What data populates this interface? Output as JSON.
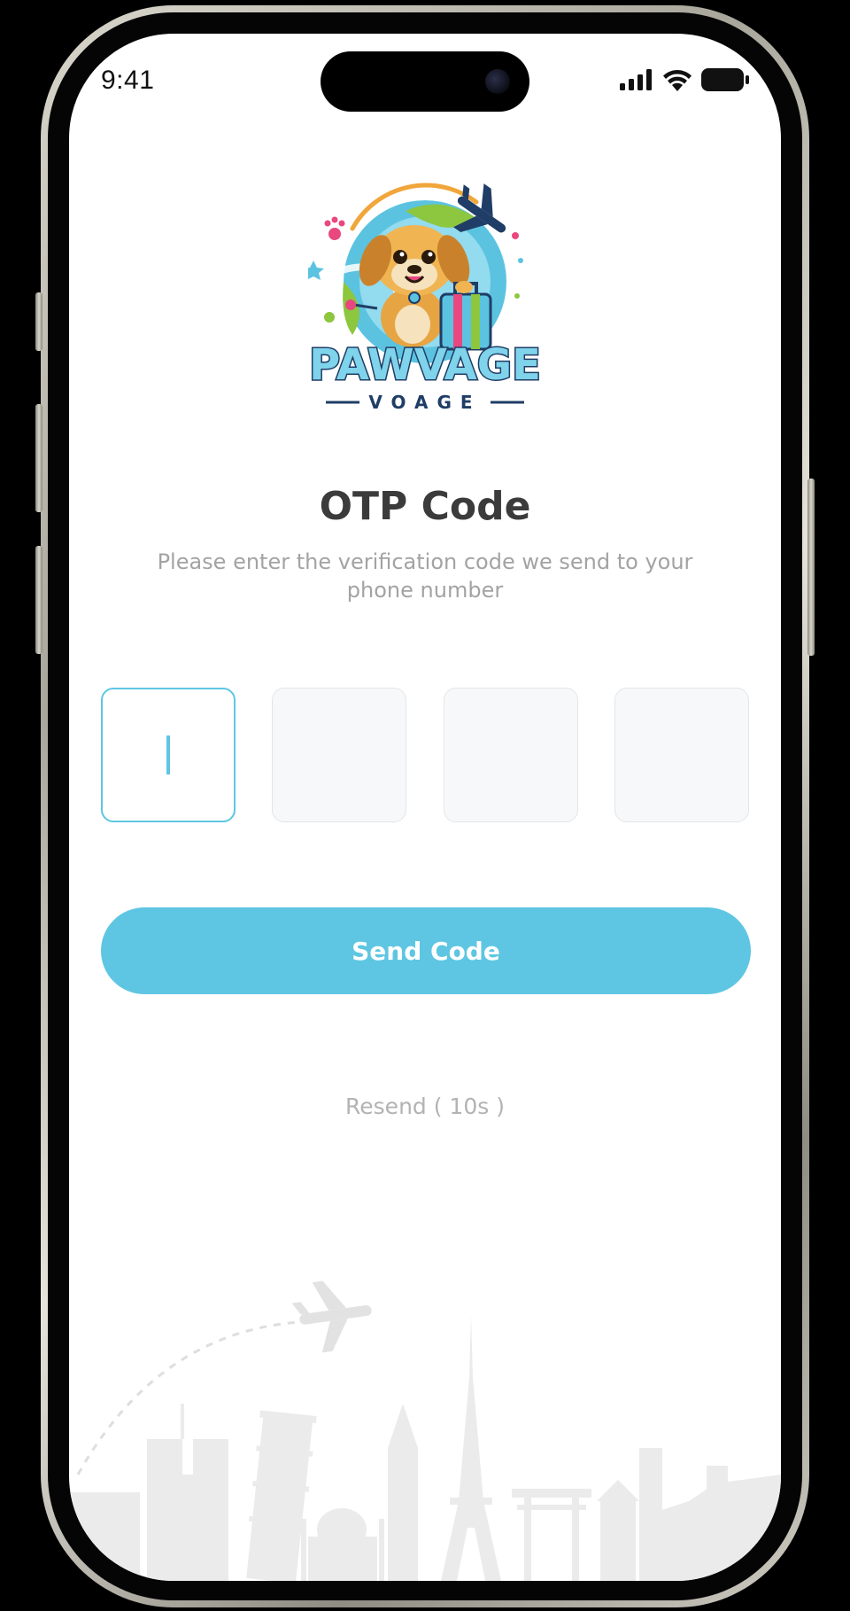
{
  "status_bar": {
    "time": "9:41",
    "icons": [
      "cellular-signal-icon",
      "wifi-icon",
      "battery-icon"
    ]
  },
  "logo": {
    "wordmark": "PAWVAGE",
    "tagline": "VOAGE"
  },
  "otp": {
    "title": "OTP Code",
    "subtitle": "Please enter the verification code we send to your phone number",
    "digits": [
      "",
      "",
      "",
      ""
    ]
  },
  "actions": {
    "send_label": "Send Code",
    "resend_label": "Resend ( 10s )"
  },
  "colors": {
    "accent": "#5ec6e2",
    "title": "#3b3b3b",
    "muted": "#a3a3a3",
    "box_bg": "#f7f8f9",
    "skyline": "#e9e9e9"
  }
}
